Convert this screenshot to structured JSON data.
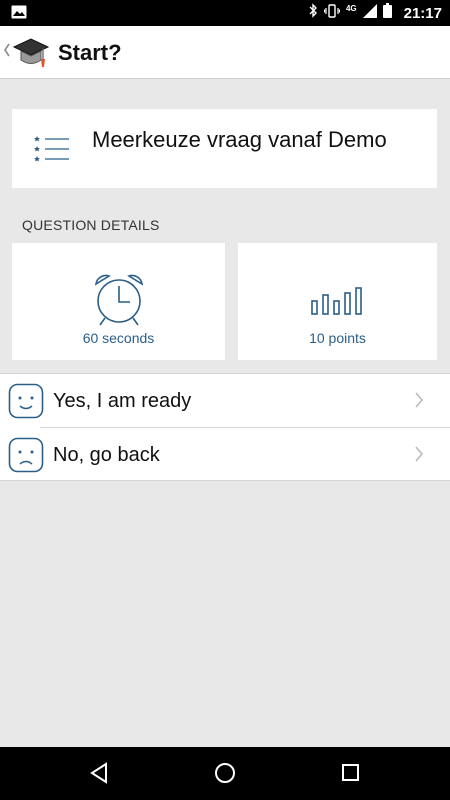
{
  "status_bar": {
    "time": "21:17",
    "network": "4G",
    "icons": [
      "image-icon",
      "bluetooth-icon",
      "vibrate-icon",
      "signal-icon",
      "battery-icon"
    ]
  },
  "app_bar": {
    "title": "Start?",
    "icons": [
      "back-chevron-icon",
      "graduation-cap-icon"
    ]
  },
  "question": {
    "title": "Meerkeuze vraag vanaf Demo",
    "icon": "list-icon"
  },
  "details": {
    "section_label": "QUESTION DETAILS",
    "time": {
      "text": "60 seconds",
      "icon": "alarm-clock-icon"
    },
    "points": {
      "text": "10 points",
      "icon": "bar-chart-icon"
    }
  },
  "actions": [
    {
      "label": "Yes, I am ready",
      "icon": "happy-face-icon"
    },
    {
      "label": "No, go back",
      "icon": "sad-face-icon"
    }
  ],
  "nav_bar": {
    "icons": [
      "back-triangle-icon",
      "home-circle-icon",
      "recents-square-icon"
    ]
  },
  "colors": {
    "accent": "#2b5e88",
    "background": "#e8e8e8",
    "card": "#ffffff"
  }
}
